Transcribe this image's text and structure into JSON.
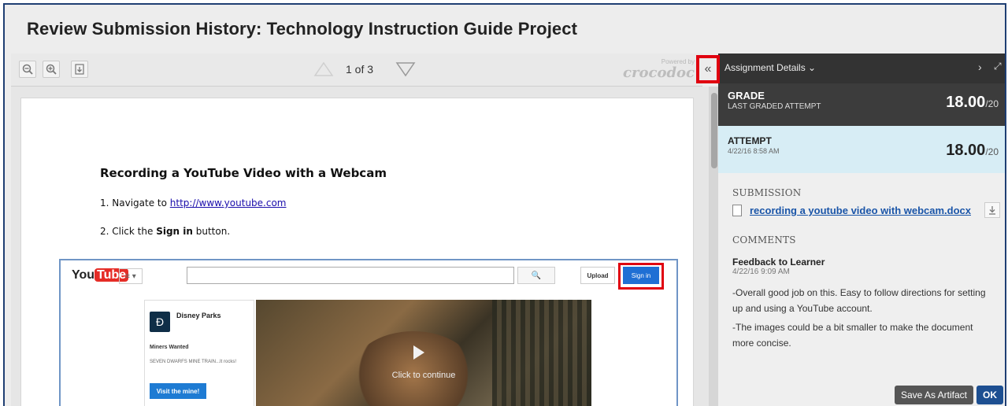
{
  "page": {
    "title": "Review Submission History: Technology Instruction Guide Project"
  },
  "viewer": {
    "zoom_out_icon": "zoom-out-icon",
    "zoom_in_icon": "zoom-in-icon",
    "download_icon": "download-icon",
    "page_count": "1 of 3",
    "powered_by": "Powered by",
    "brand": "crocodoc",
    "collapse_glyph": "«"
  },
  "document": {
    "heading": "Recording a YouTube Video with a Webcam",
    "step1_prefix": "1.  Navigate to ",
    "step1_link": "http://www.youtube.com",
    "step2_prefix": "2.  Click the ",
    "step2_bold": "Sign in",
    "step2_suffix": " button.",
    "screenshot": {
      "logo_you": "You",
      "logo_tube": "Tube",
      "menu": "≡ ▾",
      "search_icon": "🔍",
      "upload": "Upload",
      "signin": "Sign in",
      "ad_title": "Disney Parks",
      "ad_head": "Miners Wanted",
      "ad_text": "SEVEN DWARFS MINE TRAIN...It rocks!",
      "ad_button": "Visit the mine!",
      "ad_mark": "Ad",
      "video_caption": "Click to continue"
    }
  },
  "panel": {
    "title": "Assignment Details ⌄",
    "next": "›",
    "expand": "⤢",
    "grade": {
      "label": "GRADE",
      "sub": "LAST GRADED ATTEMPT",
      "value": "18.00",
      "den": "/20"
    },
    "attempt": {
      "label": "ATTEMPT",
      "date": "4/22/16 8:58 AM",
      "value": "18.00",
      "den": "/20"
    },
    "submission_head": "SUBMISSION",
    "file_name": "recording a youtube video with webcam.docx",
    "comments_head": "COMMENTS",
    "feedback_title": "Feedback to Learner",
    "feedback_date": "4/22/16 9:09 AM",
    "feedback_lines": [
      "-Overall good job on this. Easy to follow directions for setting",
      "up and using a YouTube account.",
      "-The images could be a bit smaller to make the document",
      "more concise."
    ],
    "btn_artifact": "Save As Artifact",
    "btn_ok": "OK"
  }
}
